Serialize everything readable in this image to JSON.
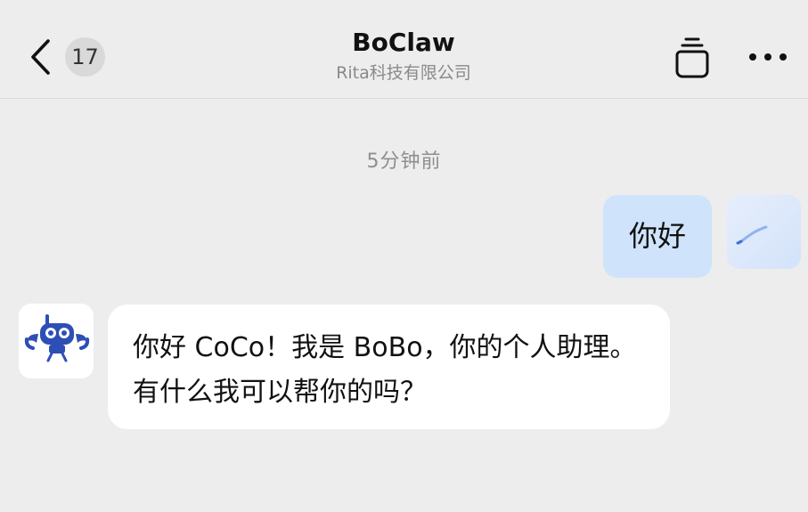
{
  "header": {
    "unread_count": "17",
    "title": "BoClaw",
    "subtitle": "Rita科技有限公司",
    "back_icon": "chevron-left-icon",
    "clipboard_icon": "clipboard-icon",
    "more_icon": "more-horizontal-icon"
  },
  "messages": {
    "timestamp": "5分钟前",
    "outgoing_text": "你好",
    "incoming_text": "你好 CoCo！我是 BoBo，你的个人助理。有什么我可以帮你的吗？"
  },
  "colors": {
    "background": "#ededed",
    "outgoing_bubble": "#cfe3fb",
    "incoming_bubble": "#ffffff",
    "bot_brand_blue": "#2d4fb5"
  }
}
